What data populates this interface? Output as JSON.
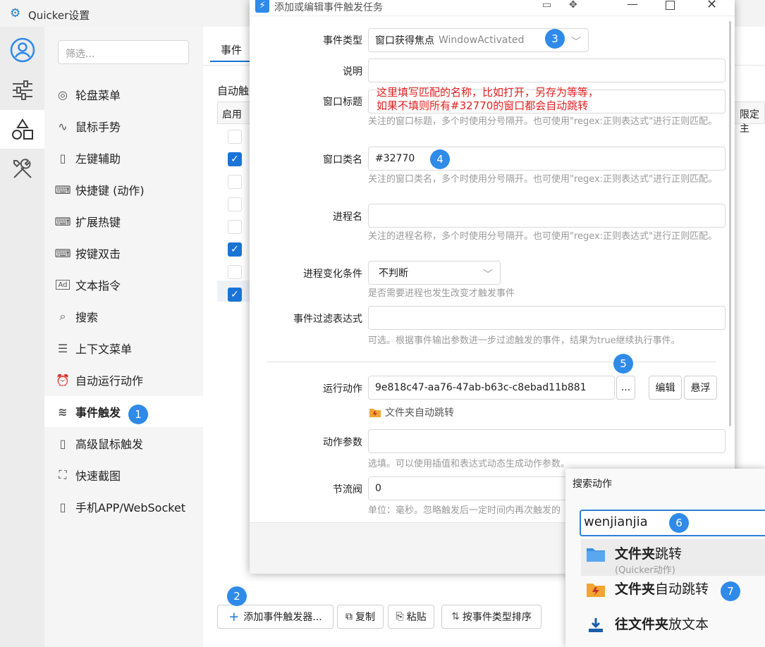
{
  "main": {
    "title": "Quicker设置",
    "filter_placeholder": "筛选...",
    "nav": [
      {
        "label": "轮盘菜单",
        "icon": "wheel-icon"
      },
      {
        "label": "鼠标手势",
        "icon": "gesture-icon"
      },
      {
        "label": "左键辅助",
        "icon": "mouse-icon"
      },
      {
        "label": "快捷键 (动作)",
        "icon": "keyboard-icon"
      },
      {
        "label": "扩展热键",
        "icon": "keyboard-icon"
      },
      {
        "label": "按键双击",
        "icon": "keyboard-icon"
      },
      {
        "label": "文本指令",
        "icon": "ad-icon"
      },
      {
        "label": "搜索",
        "icon": "search-icon"
      },
      {
        "label": "上下文菜单",
        "icon": "menu-icon"
      },
      {
        "label": "自动运行动作",
        "icon": "alarm-icon"
      },
      {
        "label": "事件触发",
        "icon": "wind-icon"
      },
      {
        "label": "高级鼠标触发",
        "icon": "mouse-icon"
      },
      {
        "label": "快速截图",
        "icon": "screenshot-icon"
      },
      {
        "label": "手机APP/WebSocket",
        "icon": "phone-icon"
      }
    ],
    "tab_label": "事件",
    "section_label": "自动触",
    "table": {
      "col_enabled": "启用",
      "col_right": "限定主"
    },
    "rows_checked": [
      false,
      true,
      false,
      false,
      false,
      true,
      false,
      true
    ],
    "buttons": {
      "add": "添加事件触发器...",
      "copy": "复制",
      "paste": "粘贴",
      "sort": "按事件类型排序"
    }
  },
  "dialog": {
    "title": "添加或编辑事件触发任务",
    "event_type": {
      "label": "事件类型",
      "value": "窗口获得焦点",
      "value_en": "WindowActivated"
    },
    "description": {
      "label": "说明",
      "value": ""
    },
    "window_title": {
      "label": "窗口标题",
      "line1": "这里填写匹配的名称，比如打开，另存为等等，",
      "line2": "如果不填则所有#32770的窗口都会自动跳转",
      "hint": "关注的窗口标题，多个时使用分号隔开。也可使用\"regex:正则表达式\"进行正则匹配。"
    },
    "window_class": {
      "label": "窗口类名",
      "value": "#32770",
      "hint": "关注的窗口类名，多个时使用分号隔开。也可使用\"regex:正则表达式\"进行正则匹配。"
    },
    "process": {
      "label": "进程名",
      "value": "",
      "hint": "关注的进程名称，多个时使用分号隔开。也可使用\"regex:正则表达式\"进行正则匹配。"
    },
    "process_change": {
      "label": "进程变化条件",
      "value": "不判断",
      "hint": "是否需要进程也发生改变才触发事件"
    },
    "filter_expr": {
      "label": "事件过滤表达式",
      "value": "",
      "hint": "可选。根据事件输出参数进一步过滤触发的事件，结果为true继续执行事件。"
    },
    "run_action": {
      "label": "运行动作",
      "value": "9e818c47-aa76-47ab-b63c-c8ebad11b881",
      "more": "...",
      "edit": "编辑",
      "float": "悬浮",
      "action_name": "文件夹自动跳转"
    },
    "action_params": {
      "label": "动作参数",
      "value": "",
      "hint": "选填。可以使用插值和表达式动态生成动作参数。"
    },
    "throttle": {
      "label": "节流阀",
      "value": "0",
      "hint": "单位：毫秒。忽略触发后一定时间内再次触发的"
    }
  },
  "search": {
    "title": "搜索动作",
    "query": "wenjianjia",
    "results": [
      {
        "bold": "文件夹",
        "rest": "跳转",
        "sub": "(Quicker动作)",
        "icon": "folder-blue-icon"
      },
      {
        "bold": "文件夹",
        "rest": "自动跳转",
        "sub": "",
        "icon": "folder-orange-icon"
      },
      {
        "bold": "往文件夹",
        "rest": "放文本",
        "sub": "",
        "icon": "download-icon"
      }
    ]
  },
  "badges": [
    "1",
    "2",
    "3",
    "4",
    "5",
    "6",
    "7"
  ],
  "colors": {
    "accent": "#2f8ae8",
    "check": "#1a73d6",
    "annotation": "#e02020"
  }
}
